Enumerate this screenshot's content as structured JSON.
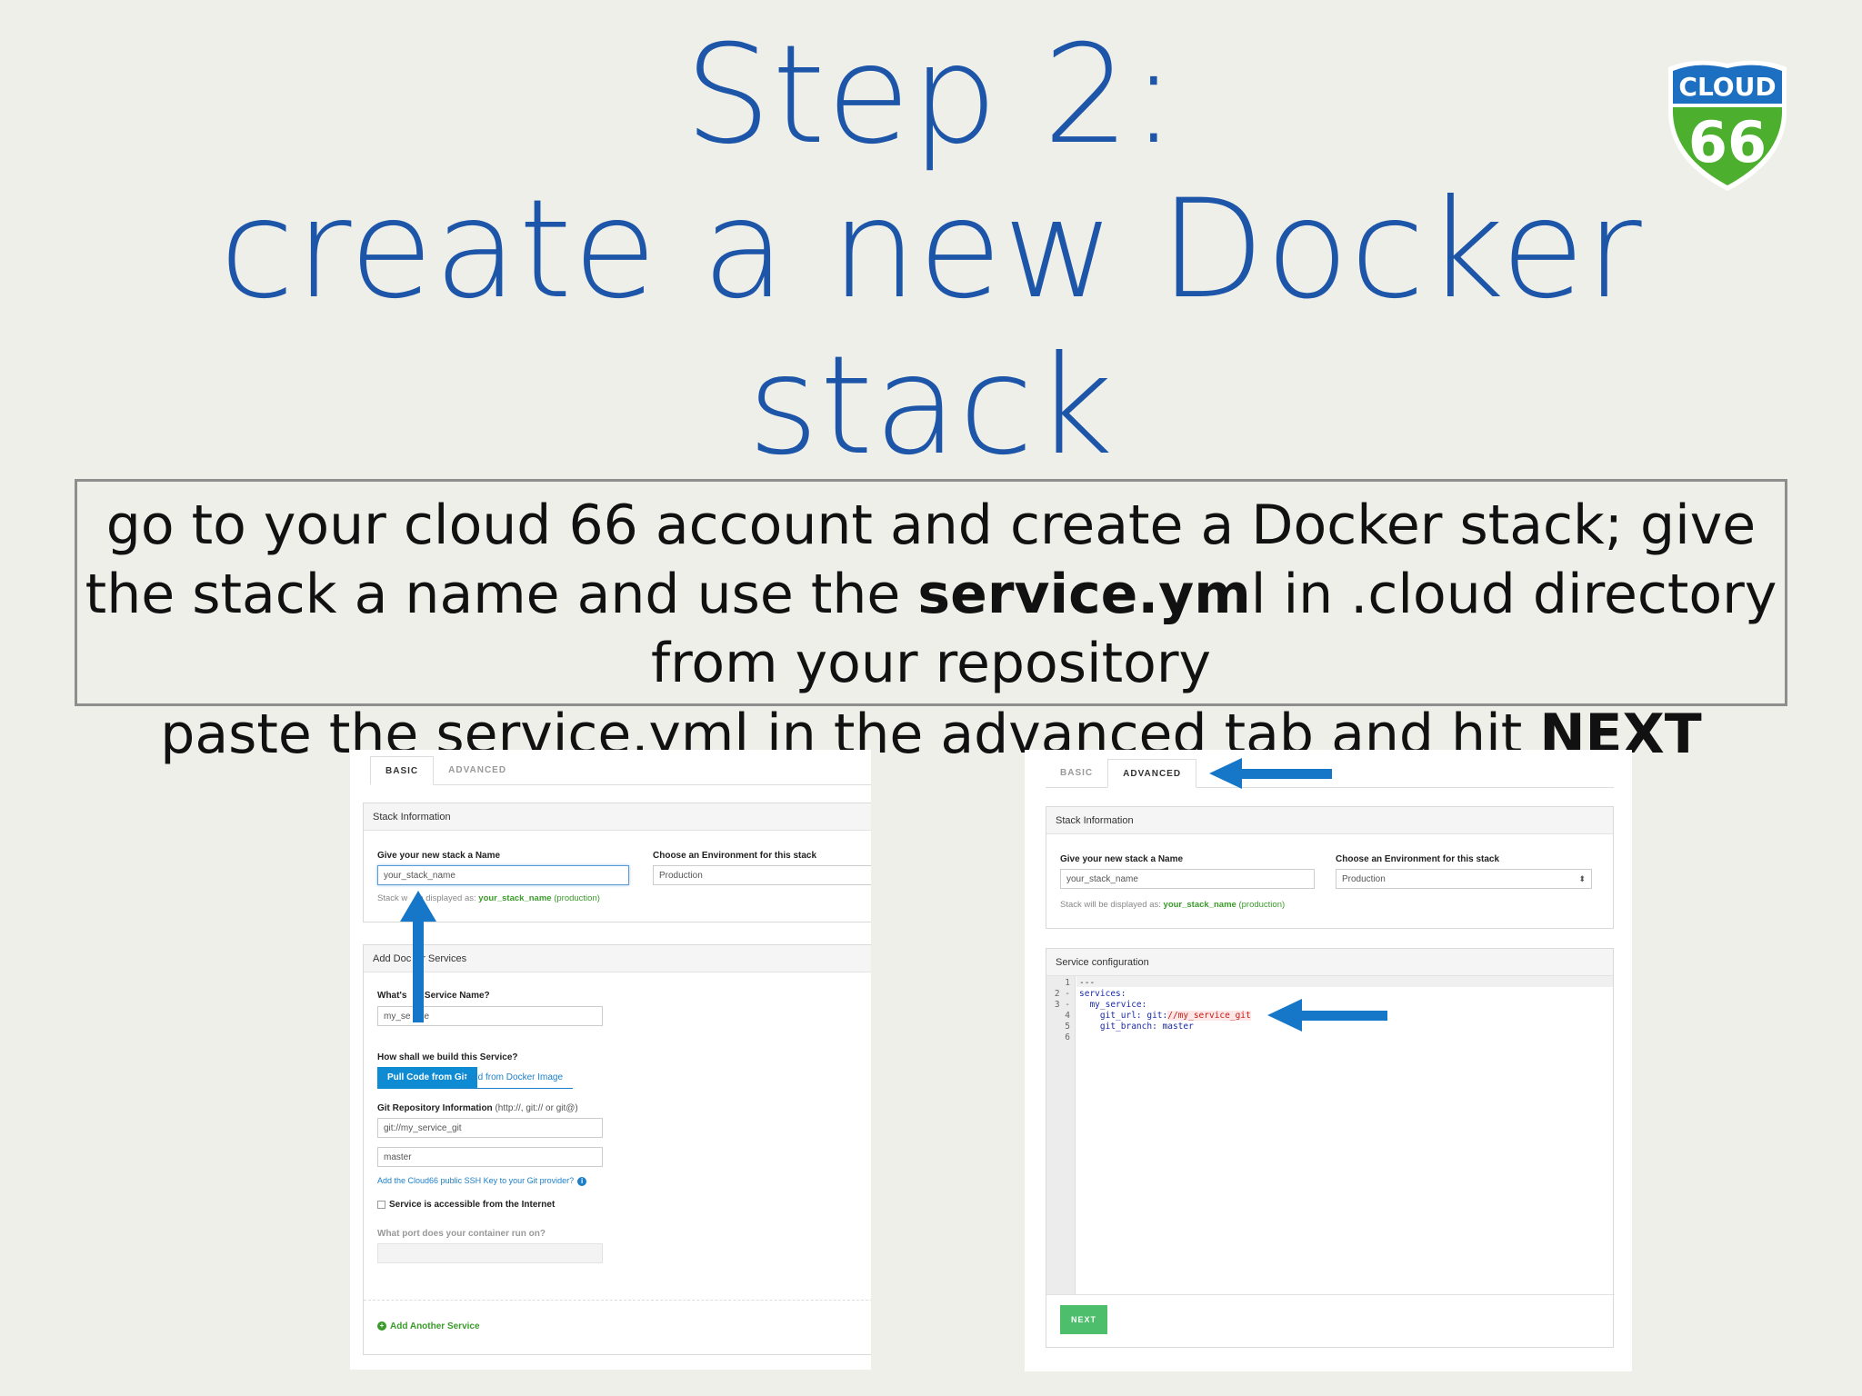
{
  "slide": {
    "title_line1": "Step 2:",
    "title_line2": "create a new Docker",
    "title_line3": "stack",
    "logo": {
      "top_text": "CLOUD",
      "number": "66",
      "colors": {
        "blue": "#1d6fc1",
        "green": "#4caf2e",
        "white": "#ffffff"
      }
    },
    "instruction": {
      "part1": "go to your cloud 66 account and create a Docker stack; give the stack a name and  use the ",
      "bold": "service.ym",
      "part2": "l in .cloud directory from your repository"
    },
    "paste": {
      "text": "paste the service.yml in the advanced tab and hit ",
      "bold": "NEXT"
    }
  },
  "left_shot": {
    "tabs": [
      "BASIC",
      "ADVANCED"
    ],
    "active_tab": "BASIC",
    "stack_info": {
      "heading": "Stack Information",
      "name_label": "Give your new stack a Name",
      "name_value": "your_stack_name",
      "env_label": "Choose an Environment for this stack",
      "env_value": "Production",
      "display_prefix": "Stack w",
      "display_mid": "e displayed as: ",
      "display_name": "your_stack_name",
      "display_env": " (production)"
    },
    "services": {
      "heading_a": "Add Doc",
      "heading_b": "r Services",
      "service_label_a": "What's ",
      "service_label_b": " Service Name?",
      "service_value_a": "my_se",
      "service_value_b": "ce",
      "build_label": "How shall we build this Service?",
      "build_git": "Pull Code from Git",
      "build_docker": "Build from Docker Image",
      "git_label": "Git Repository Information",
      "git_hint": " (http://, git:// or git@)",
      "git_url": "git://my_service_git",
      "git_branch": "master",
      "ssh_link": "Add the Cloud66 public SSH Key to your Git provider?",
      "info": "i",
      "accessible": "Service is accessible from the Internet",
      "port_label": "What port does your container run on?",
      "add_service": "Add Another Service",
      "plus": "+"
    }
  },
  "right_shot": {
    "tabs": [
      "BASIC",
      "ADVANCED"
    ],
    "active_tab": "ADVANCED",
    "stack_info": {
      "heading": "Stack Information",
      "name_label": "Give your new stack a Name",
      "name_value": "your_stack_name",
      "env_label": "Choose an Environment for this stack",
      "env_value": "Production",
      "select_arrow": "⬍",
      "display_prefix": "Stack will be displayed as: ",
      "display_name": "your_stack_name",
      "display_env": " (production)"
    },
    "service_config": {
      "heading": "Service configuration",
      "line_numbers": [
        "1",
        "2 -",
        "3 -",
        "4",
        "5",
        "6"
      ],
      "code": {
        "l1": "---",
        "l2": "services:",
        "l3": "  my_service:",
        "l4_key": "    git_url: git:",
        "l4_val": "//my_service_git",
        "l5": "    git_branch: master"
      }
    },
    "next": "NEXT"
  },
  "colors": {
    "title_blue": "#1d55a8",
    "arrow_blue": "#1677c8",
    "next_green": "#4cbe6c",
    "link_blue": "#1c7fc8",
    "git_green": "#3a9b2a"
  }
}
